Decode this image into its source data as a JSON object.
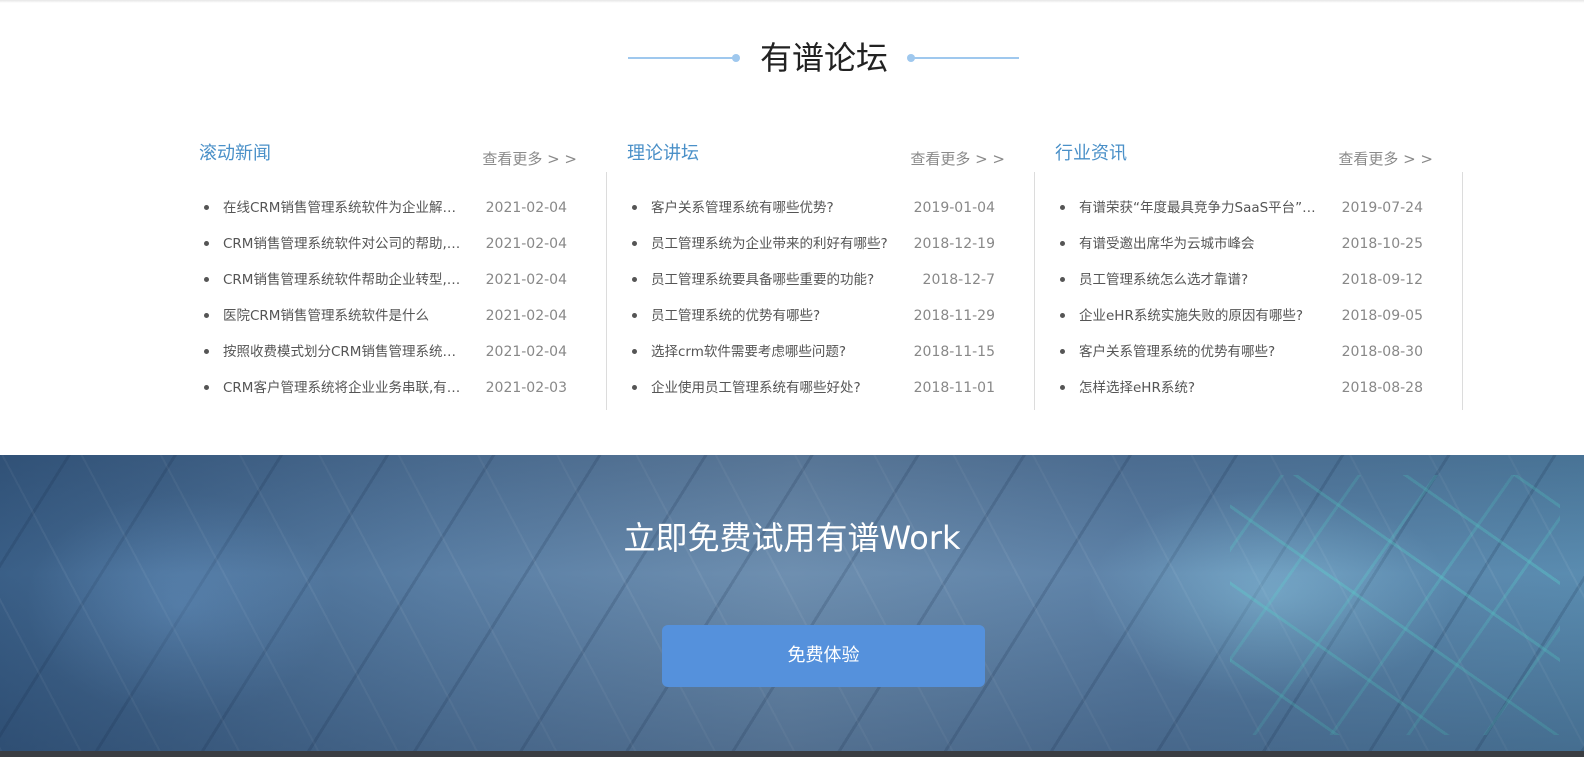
{
  "forum": {
    "heading": "有谱论坛",
    "columns": [
      {
        "title": "滚动新闻",
        "more": "查看更多 > >",
        "items": [
          {
            "title": "在线CRM销售管理系统软件为企业解决销售难题",
            "date": "2021-02-04"
          },
          {
            "title": "CRM销售管理系统软件对公司的帮助,有哪些",
            "date": "2021-02-04"
          },
          {
            "title": "CRM销售管理系统软件帮助企业转型,提升业绩",
            "date": "2021-02-04"
          },
          {
            "title": "医院CRM销售管理系统软件是什么",
            "date": "2021-02-04"
          },
          {
            "title": "按照收费模式划分CRM销售管理系统软件有哪些",
            "date": "2021-02-04"
          },
          {
            "title": "CRM客户管理系统将企业业务串联,有效提升效率",
            "date": "2021-02-03"
          }
        ]
      },
      {
        "title": "理论讲坛",
        "more": "查看更多 > >",
        "items": [
          {
            "title": "客户关系管理系统有哪些优势?",
            "date": "2019-01-04"
          },
          {
            "title": "员工管理系统为企业带来的利好有哪些?",
            "date": "2018-12-19"
          },
          {
            "title": "员工管理系统要具备哪些重要的功能?",
            "date": "2018-12-7"
          },
          {
            "title": "员工管理系统的优势有哪些?",
            "date": "2018-11-29"
          },
          {
            "title": "选择crm软件需要考虑哪些问题?",
            "date": "2018-11-15"
          },
          {
            "title": "企业使用员工管理系统有哪些好处?",
            "date": "2018-11-01"
          }
        ]
      },
      {
        "title": "行业资讯",
        "more": "查看更多 > >",
        "items": [
          {
            "title": "有谱荣获“年度最具竞争力SaaS平台”称号",
            "date": "2019-07-24"
          },
          {
            "title": "有谱受邀出席华为云城市峰会",
            "date": "2018-10-25"
          },
          {
            "title": "员工管理系统怎么选才靠谱?",
            "date": "2018-09-12"
          },
          {
            "title": "企业eHR系统实施失败的原因有哪些?",
            "date": "2018-09-05"
          },
          {
            "title": "客户关系管理系统的优势有哪些?",
            "date": "2018-08-30"
          },
          {
            "title": "怎样选择eHR系统?",
            "date": "2018-08-28"
          }
        ]
      }
    ]
  },
  "cta": {
    "title": "立即免费试用有谱Work",
    "button": "免费体验"
  }
}
